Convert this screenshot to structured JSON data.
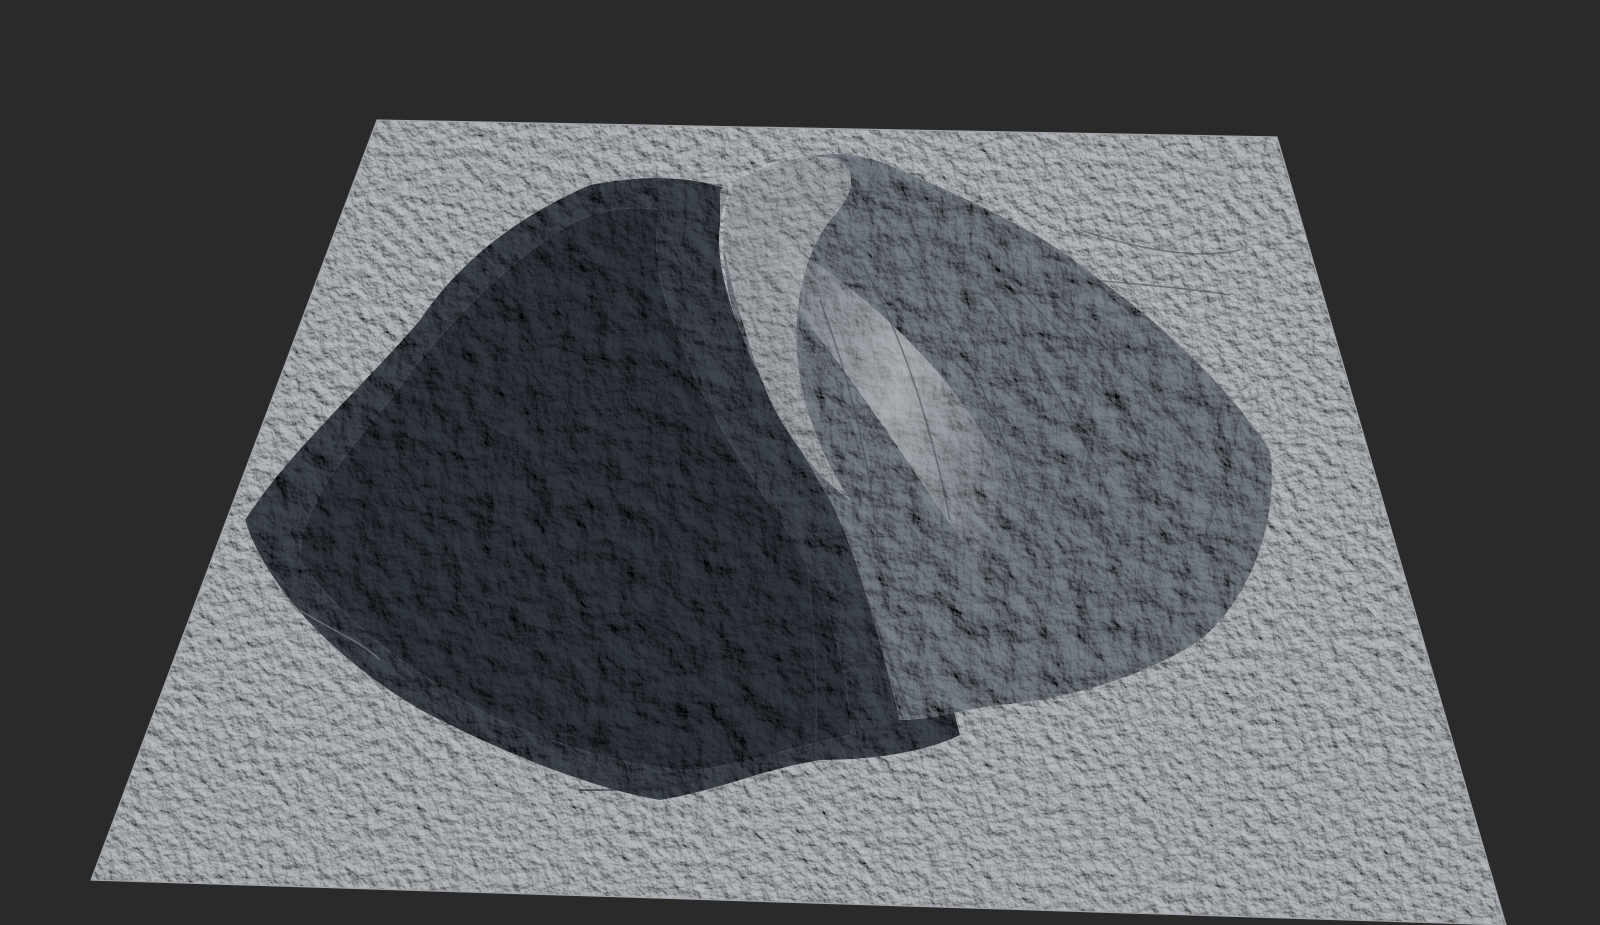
{
  "scene": {
    "background_color": "#2a2a2a",
    "terrain": {
      "base_color": "#b7bbbf",
      "light_color": "#cfd3d6",
      "shadow_color": "#3c4148",
      "dark_rock_color": "#2f343b"
    }
  }
}
